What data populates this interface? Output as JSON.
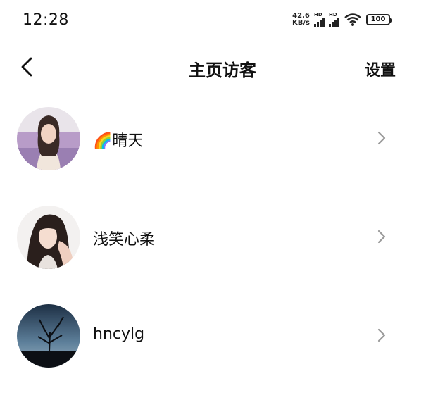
{
  "status_bar": {
    "time": "12:28",
    "net_speed_value": "42.6",
    "net_speed_unit": "KB/s",
    "hd_label": "HD",
    "battery": "100"
  },
  "nav": {
    "title": "主页访客",
    "settings": "设置"
  },
  "visitors": [
    {
      "name": "🌈晴天",
      "avatar": "avatar-woman-lavender-field"
    },
    {
      "name": "浅笑心柔",
      "avatar": "avatar-woman-dark-hair"
    },
    {
      "name": "hncylg",
      "avatar": "avatar-bare-tree-dusk"
    }
  ],
  "colors": {
    "text": "#111111",
    "chevron": "#9a9a9a",
    "background": "#ffffff"
  }
}
